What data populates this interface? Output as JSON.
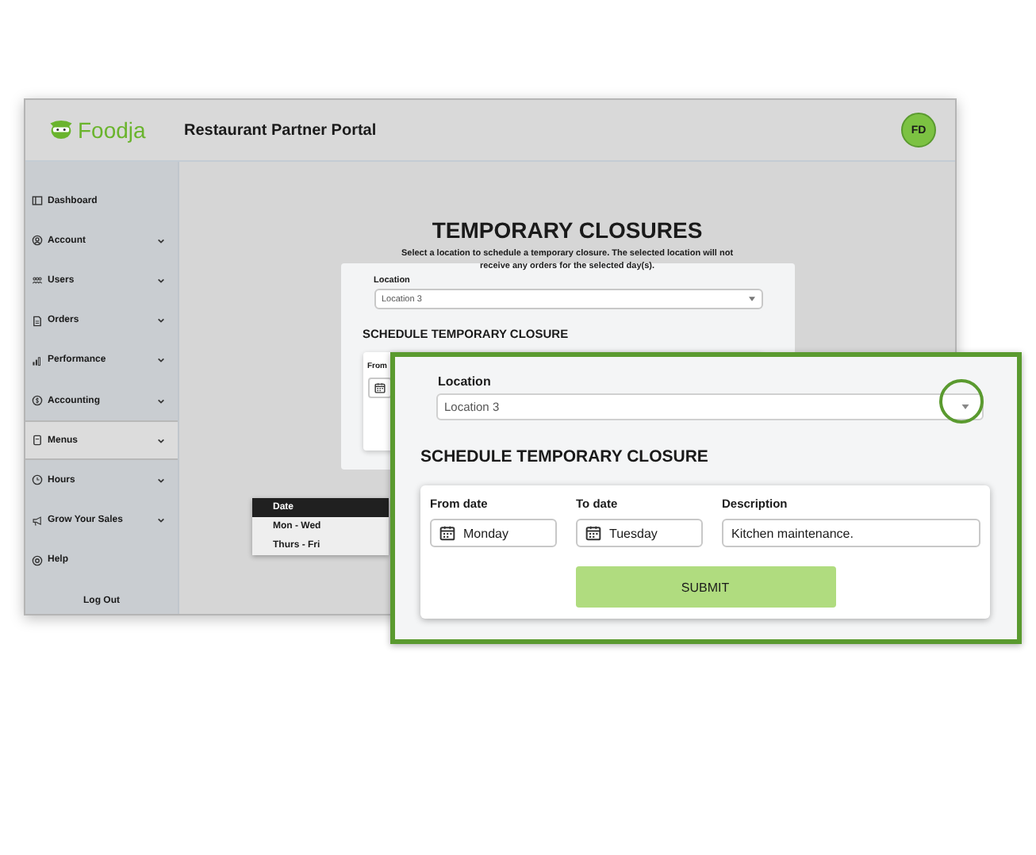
{
  "window": {
    "logo": "Foodja",
    "title": "Restaurant Partner Portal",
    "avatar": "FD"
  },
  "sidebar": {
    "items": [
      {
        "label": "Dashboard",
        "expandable": false,
        "selected": false
      },
      {
        "label": "Account",
        "expandable": true,
        "selected": false
      },
      {
        "label": "Users",
        "expandable": true,
        "selected": false
      },
      {
        "label": "Orders",
        "expandable": true,
        "selected": false
      },
      {
        "label": "Performance",
        "expandable": true,
        "selected": false
      },
      {
        "label": "Accounting",
        "expandable": true,
        "selected": false
      },
      {
        "label": "Menus",
        "expandable": true,
        "selected": true
      },
      {
        "label": "Hours",
        "expandable": true,
        "selected": false
      },
      {
        "label": "Grow Your Sales",
        "expandable": true,
        "selected": false
      },
      {
        "label": "Help",
        "expandable": false,
        "selected": false
      }
    ],
    "logout": "Log Out"
  },
  "main": {
    "title": "TEMPORARY CLOSURES",
    "subtitle": "Select a location to schedule a temporary closure. The selected location will not receive any orders for the selected day(s).",
    "location_label": "Location",
    "location_value": "Location 3",
    "schedule_heading": "SCHEDULE TEMPORARY CLOSURE",
    "from_label": "From"
  },
  "popup_table": {
    "header": "Date",
    "rows": [
      "Mon - Wed",
      "Thurs - Fri"
    ]
  },
  "callout": {
    "location_label": "Location",
    "location_value": "Location 3",
    "schedule_heading": "SCHEDULE TEMPORARY CLOSURE",
    "fields": [
      {
        "label": "From date",
        "value": "Monday",
        "kind": "date"
      },
      {
        "label": "To date",
        "value": "Tuesday",
        "kind": "date"
      },
      {
        "label": "Description",
        "value": "Kitchen maintenance.",
        "kind": "text"
      }
    ],
    "submit": "SUBMIT"
  }
}
